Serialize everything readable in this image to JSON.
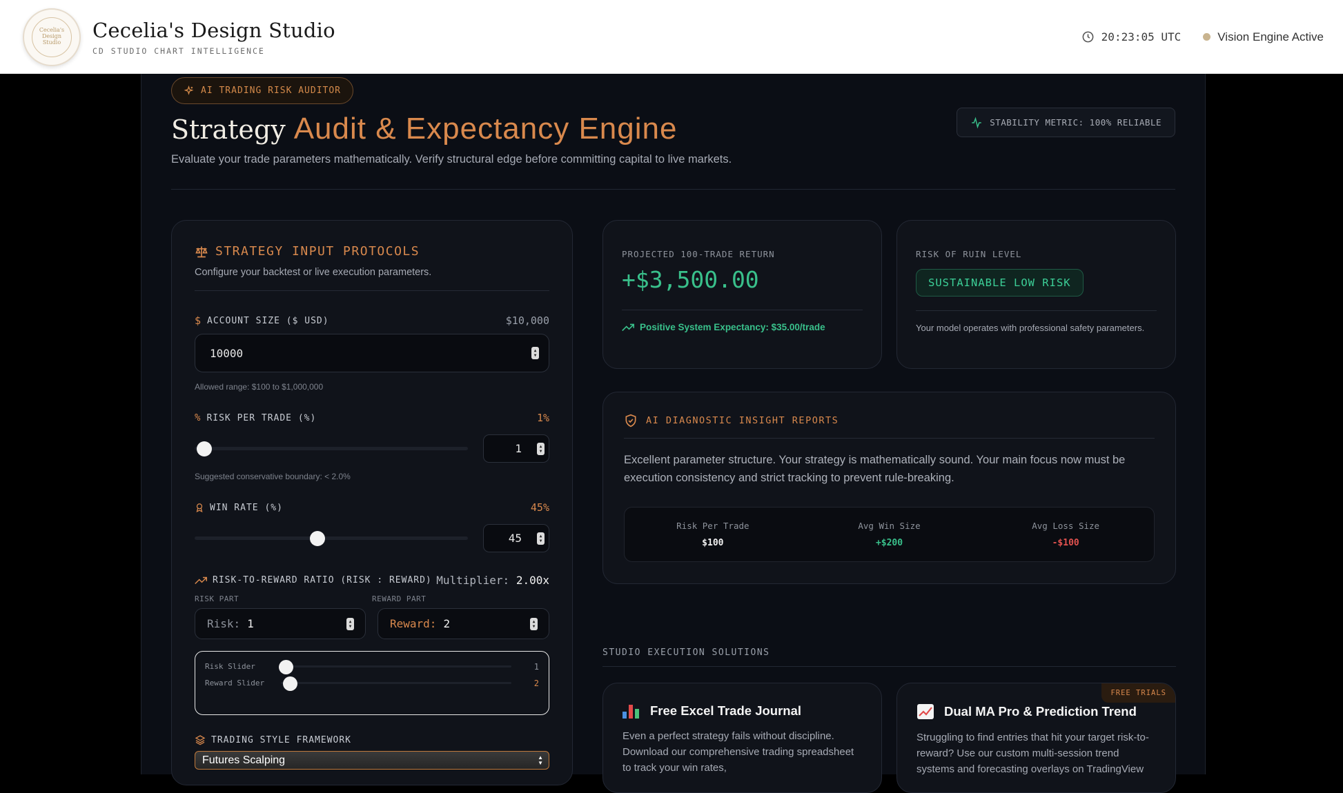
{
  "header": {
    "logo_text": "Cecelia's Design Studio",
    "title": "Cecelia's Design Studio",
    "subtitle": "CD STUDIO CHART INTELLIGENCE",
    "time": "20:23:05 UTC",
    "status": "Vision Engine Active",
    "status_color": "#c9b48f"
  },
  "hero": {
    "badge": "AI TRADING RISK AUDITOR",
    "title_a": "Strategy",
    "title_b": "Audit & Expectancy Engine",
    "lead": "Evaluate your trade parameters mathematically. Verify structural edge before committing capital to live markets.",
    "stability": "STABILITY METRIC: 100% RELIABLE"
  },
  "inputs": {
    "title": "STRATEGY INPUT PROTOCOLS",
    "subtitle": "Configure your backtest or live execution parameters.",
    "account": {
      "label": "ACCOUNT SIZE ($ USD)",
      "display": "$10,000",
      "value": "10000",
      "hint": "Allowed range: $100 to $1,000,000"
    },
    "risk": {
      "label": "RISK PER TRADE (%)",
      "display": "1%",
      "value": "1",
      "level": 0.0,
      "hint": "Suggested conservative boundary: < 2.0%"
    },
    "winrate": {
      "label": "WIN RATE (%)",
      "display": "45%",
      "value": "45",
      "level": 0.45
    },
    "rr": {
      "label": "RISK-TO-REWARD RATIO (RISK : REWARD)",
      "mult_label": "Multiplier:",
      "mult_value": "2.00x",
      "risk_part_label": "RISK PART",
      "reward_part_label": "REWARD PART",
      "risk_prefix": "Risk:",
      "risk_value": "1",
      "reward_prefix": "Reward:",
      "reward_value": "2",
      "risk_slider_label": "Risk Slider",
      "risk_slider_value": "1",
      "reward_slider_label": "Reward Slider",
      "reward_slider_value": "2"
    },
    "style": {
      "label": "TRADING STYLE FRAMEWORK",
      "selected": "Futures Scalping"
    }
  },
  "projection": {
    "label": "PROJECTED 100-TRADE RETURN",
    "value": "+$3,500.00",
    "foot": "Positive System Expectancy: $35.00/trade"
  },
  "ruin": {
    "label": "RISK OF RUIN LEVEL",
    "pill": "SUSTAINABLE LOW RISK",
    "desc": "Your model operates with professional safety parameters."
  },
  "ai": {
    "title": "AI DIAGNOSTIC INSIGHT REPORTS",
    "text": "Excellent parameter structure. Your strategy is mathematically sound. Your main focus now must be execution consistency and strict tracking to prevent rule-breaking.",
    "metrics": [
      {
        "label": "Risk Per Trade",
        "value": "$100"
      },
      {
        "label": "Avg Win Size",
        "value": "+$200"
      },
      {
        "label": "Avg Loss Size",
        "value": "-$100"
      }
    ]
  },
  "solutions": {
    "title": "STUDIO EXECUTION SOLUTIONS",
    "cards": [
      {
        "icon": "bar-chart-icon",
        "title": "Free Excel Trade Journal",
        "desc": "Even a perfect strategy fails without discipline. Download our comprehensive trading spreadsheet to track your win rates,"
      },
      {
        "icon": "trend-up-chart-icon",
        "title": "Dual MA Pro & Prediction Trend",
        "desc": "Struggling to find entries that hit your target risk-to-reward? Use our custom multi-session trend systems and forecasting overlays on TradingView",
        "badge": "FREE TRIALS"
      }
    ]
  },
  "colors": {
    "accent": "#d9894d",
    "positive": "#39c08b",
    "negative": "#e2524f",
    "panel": "#0b0e15"
  }
}
